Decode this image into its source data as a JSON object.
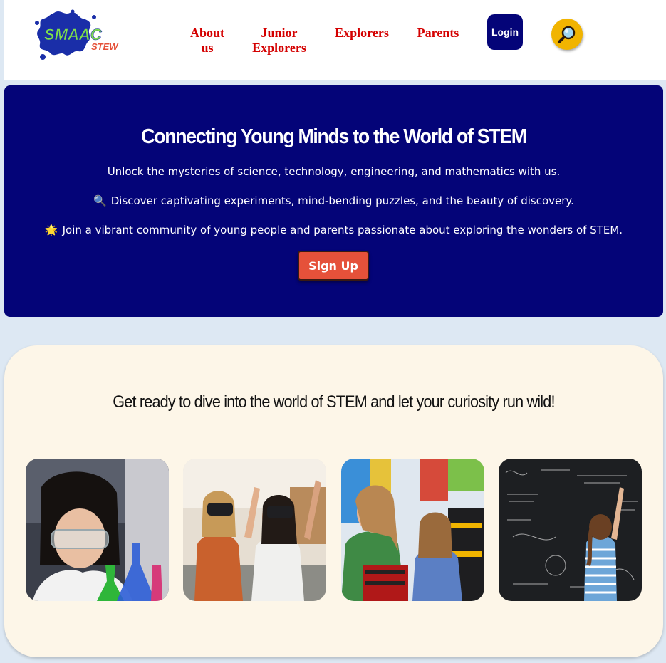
{
  "header": {
    "logo_text_top": "SMAAC",
    "logo_text_bottom": "STEW",
    "nav": {
      "about": "About us",
      "junior_explorers": "Junior Explorers",
      "explorers": "Explorers",
      "parents": "Parents"
    },
    "login_label": "Login",
    "search_icon": "magnifier-icon"
  },
  "hero": {
    "title": "Connecting Young Minds to the World of STEM",
    "line1": "Unlock the mysteries of science, technology, engineering, and mathematics with us.",
    "line2_icon": "🔍",
    "line2": "Discover captivating experiments, mind-bending puzzles, and the beauty of discovery.",
    "line3_icon": "🌟",
    "line3": "Join a vibrant community of young people and parents passionate about exploring the wonders of STEM.",
    "signup_label": "Sign Up"
  },
  "content": {
    "title": "Get ready to dive into the world of STEM and let your curiosity run wild!"
  },
  "colors": {
    "hero_bg": "#040478",
    "nav_link": "#d40000",
    "signup_bg": "#e5513a",
    "card_bg": "#fdf6e8",
    "page_bg": "#dde8f3"
  }
}
